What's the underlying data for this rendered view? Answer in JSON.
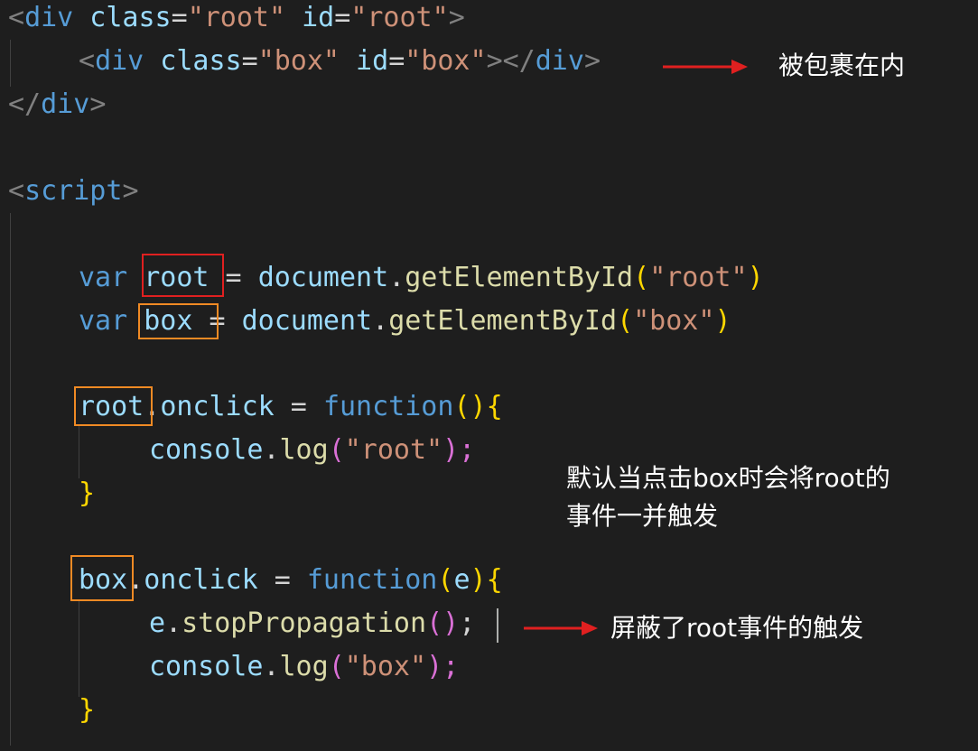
{
  "code": {
    "l1": {
      "t1": "<",
      "t2": "div",
      "t3": " class",
      "t4": "=",
      "t5": "\"root\"",
      "t6": " id",
      "t7": "=",
      "t8": "\"root\"",
      "t9": ">"
    },
    "l2": {
      "t1": "<",
      "t2": "div",
      "t3": " class",
      "t4": "=",
      "t5": "\"box\"",
      "t6": " id",
      "t7": "=",
      "t8": "\"box\"",
      "t9": "></",
      "t10": "div",
      "t11": ">"
    },
    "l3": {
      "t1": "</",
      "t2": "div",
      "t3": ">"
    },
    "l5": {
      "t1": "<",
      "t2": "script",
      "t3": ">"
    },
    "l7": {
      "t1": "var ",
      "t2": "root",
      "t3": " = ",
      "t4": "document",
      "t5": ".",
      "t6": "getElementById",
      "t7": "(",
      "t8": "\"root\"",
      "t9": ")"
    },
    "l8": {
      "t1": "var ",
      "t2": "box",
      "t3": " = ",
      "t4": "document",
      "t5": ".",
      "t6": "getElementById",
      "t7": "(",
      "t8": "\"box\"",
      "t9": ")"
    },
    "l10": {
      "t1": "root",
      "t2": ".",
      "t3": "onclick",
      "t4": " = ",
      "t5": "function",
      "t6": "()",
      "t7": "{"
    },
    "l11": {
      "t1": "console",
      "t2": ".",
      "t3": "log",
      "t4": "(",
      "t5": "\"root\"",
      "t6": ");"
    },
    "l12": {
      "t1": "}"
    },
    "l14": {
      "t1": "box",
      "t2": ".",
      "t3": "onclick",
      "t4": " = ",
      "t5": "function",
      "t6": "(",
      "t7": "e",
      "t8": ")",
      "t9": "{"
    },
    "l15": {
      "t1": "e",
      "t2": ".",
      "t3": "stopPropagation",
      "t4": "()",
      "t5": ";"
    },
    "l16": {
      "t1": "console",
      "t2": ".",
      "t3": "log",
      "t4": "(",
      "t5": "\"box\"",
      "t6": ");"
    },
    "l17": {
      "t1": "}"
    }
  },
  "annotations": {
    "note1": "被包裹在内",
    "note2_line1": "默认当点击box时会将root的",
    "note2_line2": "事件一并触发",
    "note3": "屏蔽了root事件的触发"
  },
  "colors": {
    "background": "#1e1e1e",
    "highlight_red": "#e02020",
    "highlight_orange": "#f08a24",
    "arrow_red": "#e02020"
  }
}
